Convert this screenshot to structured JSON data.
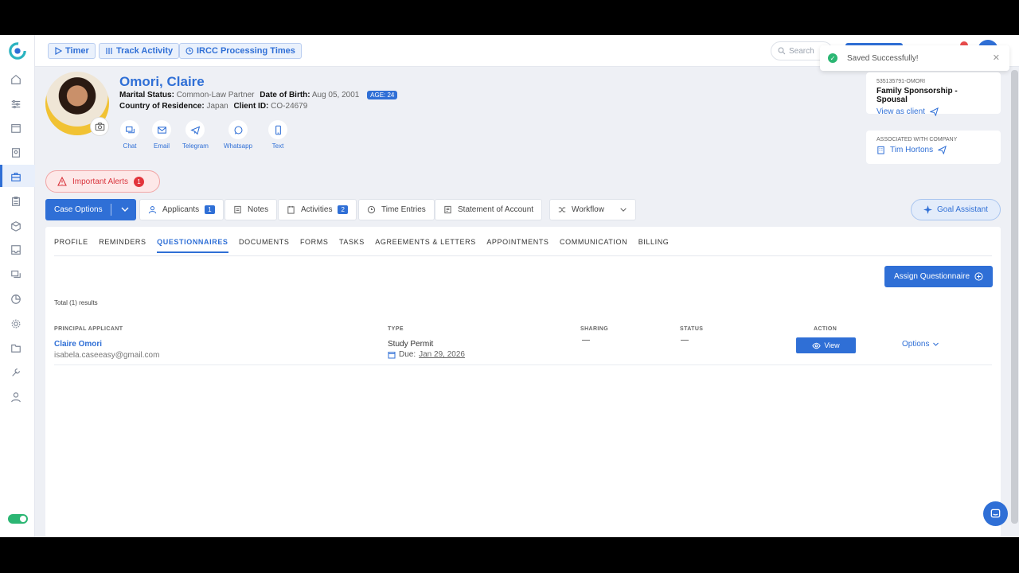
{
  "topbar": {
    "timer_label": "Timer",
    "track_label": "Track Activity",
    "ircc_label": "IRCC Processing Times",
    "search_placeholder": "Search"
  },
  "toast": {
    "message": "Saved Successfully!"
  },
  "client": {
    "name": "Omori, Claire",
    "marital_status_label": "Marital Status:",
    "marital_status": "Common-Law Partner",
    "dob_label": "Date of Birth:",
    "dob": "Aug 05, 2001",
    "age": "AGE: 24",
    "residence_label": "Country of Residence:",
    "residence": "Japan",
    "client_id_label": "Client ID:",
    "client_id": "CO-24679"
  },
  "contacts": [
    "Chat",
    "Email",
    "Telegram",
    "Whatsapp",
    "Text"
  ],
  "case_card": {
    "case_number": "535135791-OMORI",
    "case_type": "Family Sponsorship - Spousal",
    "view_as_client": "View as client"
  },
  "company_card": {
    "label": "ASSOCIATED WITH COMPANY",
    "company": "Tim Hortons"
  },
  "alerts": {
    "label": "Important Alerts",
    "count": "1"
  },
  "actions": {
    "case_options": "Case Options",
    "applicants": "Applicants",
    "applicants_count": "1",
    "notes": "Notes",
    "activities": "Activities",
    "activities_count": "2",
    "time_entries": "Time Entries",
    "statement": "Statement of Account",
    "workflow": "Workflow",
    "goal_assistant": "Goal Assistant"
  },
  "tabs": [
    "PROFILE",
    "REMINDERS",
    "QUESTIONNAIRES",
    "DOCUMENTS",
    "FORMS",
    "TASKS",
    "AGREEMENTS & LETTERS",
    "APPOINTMENTS",
    "COMMUNICATION",
    "BILLING"
  ],
  "active_tab": "QUESTIONNAIRES",
  "questionnaires": {
    "assign_label": "Assign Questionnaire",
    "total_label": "Total (1) results",
    "headers": {
      "principal": "PRINCIPAL APPLICANT",
      "type": "TYPE",
      "sharing": "SHARING",
      "status": "STATUS",
      "action": "ACTION"
    },
    "rows": [
      {
        "name": "Claire Omori",
        "email": "isabela.caseeasy@gmail.com",
        "type": "Study Permit",
        "due_label": "Due:",
        "due_date": "Jan 29, 2026",
        "sharing": "—",
        "status": "—",
        "view_label": "View",
        "options_label": "Options"
      }
    ]
  },
  "colors": {
    "primary": "#2f6fd6",
    "alert_red": "#e2343b",
    "success_green": "#2bb673"
  }
}
